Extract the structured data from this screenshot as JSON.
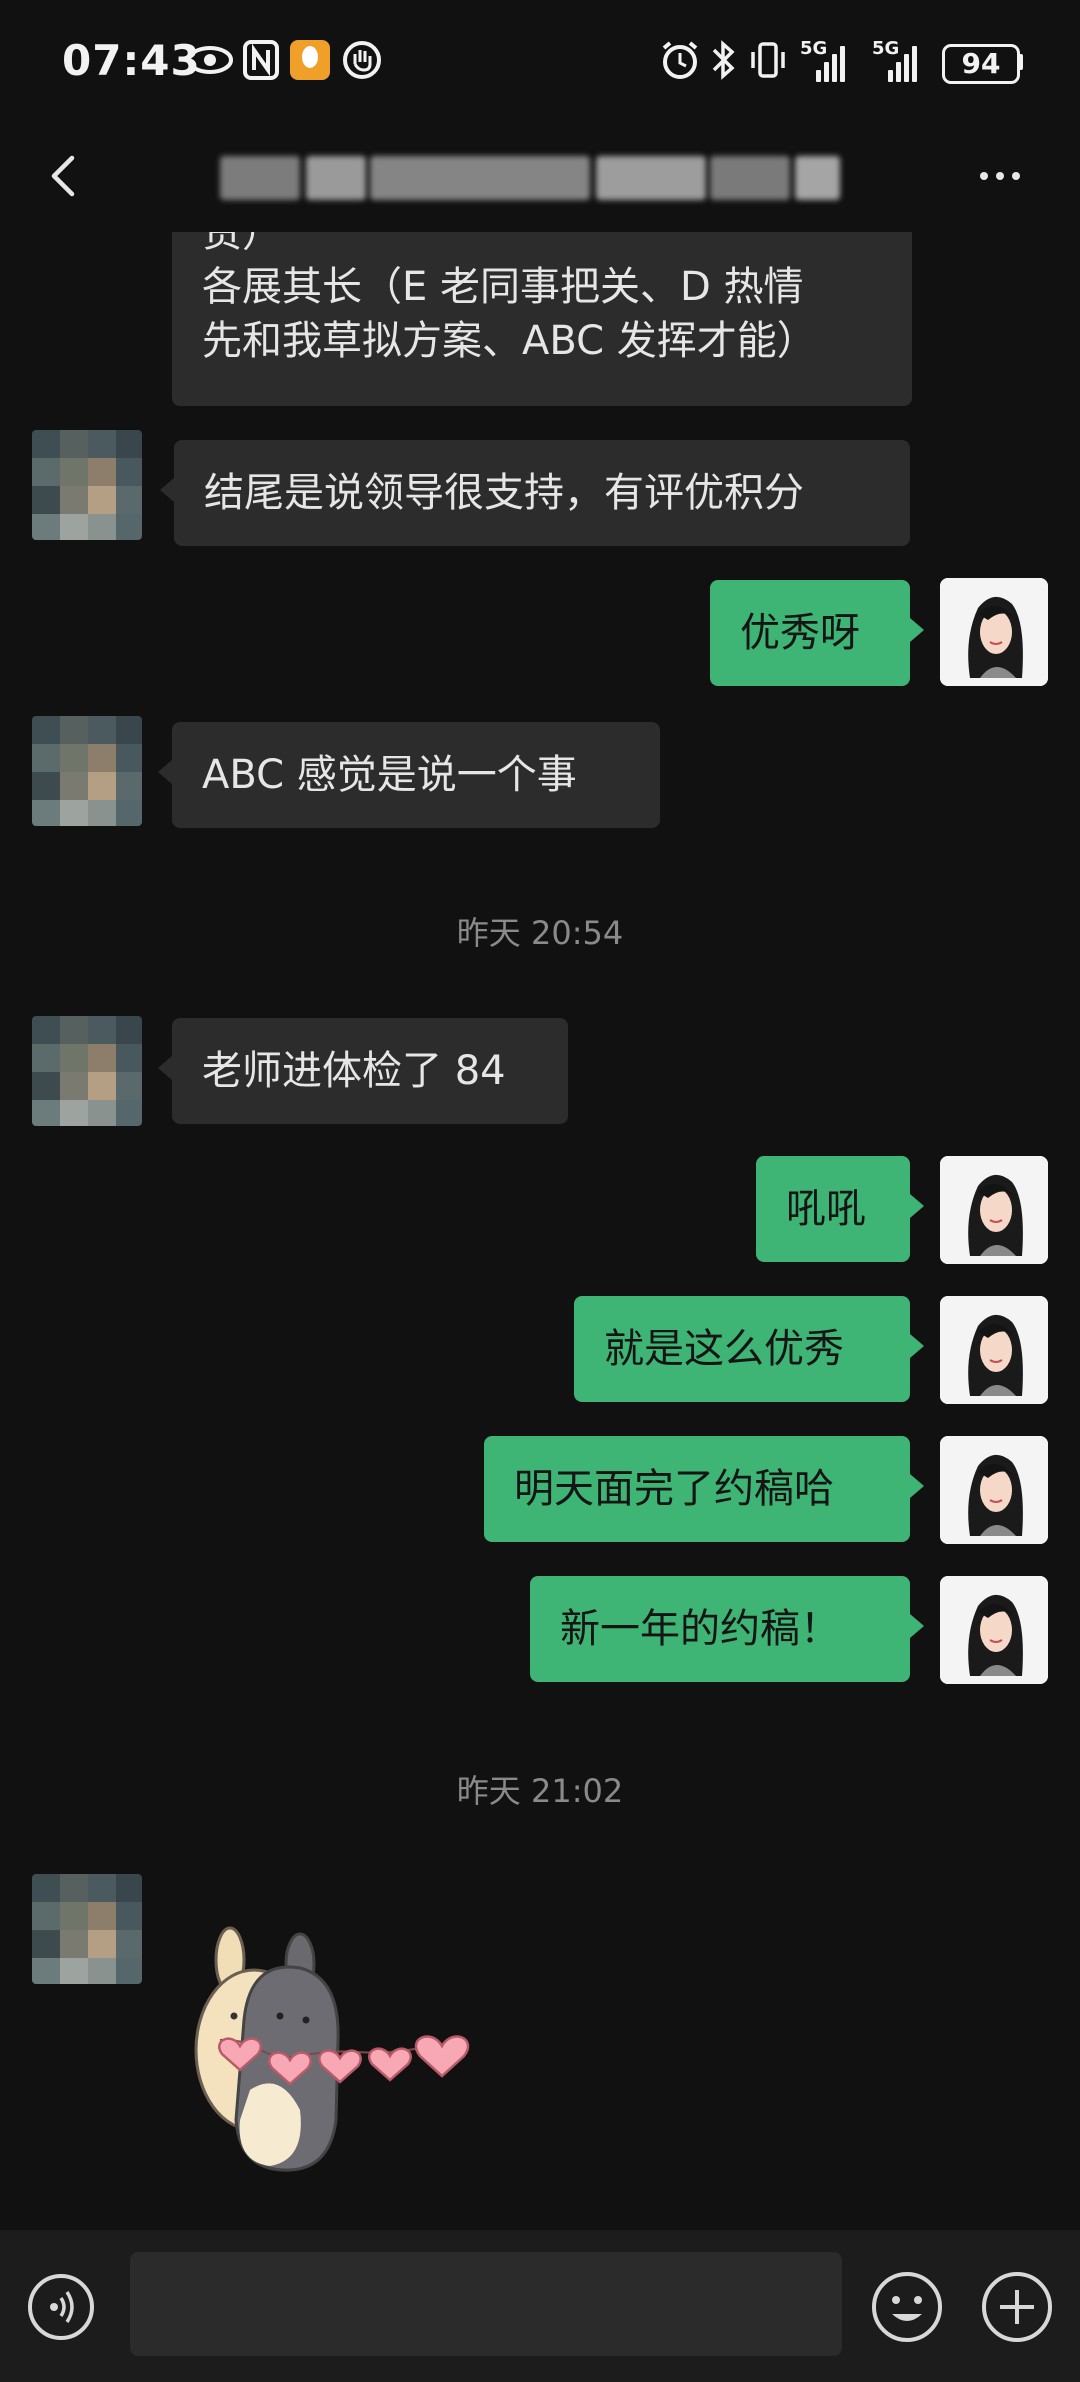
{
  "status_bar": {
    "time": "07:43",
    "signal1_label": "5G",
    "signal2_label": "5G",
    "battery": "94"
  },
  "header": {
    "title": "",
    "back_icon": "chevron-left-icon",
    "more_icon": "more-dots-icon"
  },
  "messages": [
    {
      "side": "in",
      "text_line1": "责）",
      "text_line2": "各展其长（E 老同事把关、D 热情",
      "text_line3": "先和我草拟方案、ABC 发挥才能）"
    },
    {
      "side": "in",
      "text": "结尾是说领导很支持，有评优积分"
    },
    {
      "side": "out",
      "text": "优秀呀"
    },
    {
      "side": "in",
      "text": "ABC 感觉是说一个事"
    },
    {
      "side": "in",
      "text": "老师进体检了 84"
    },
    {
      "side": "out",
      "text": "吼吼"
    },
    {
      "side": "out",
      "text": "就是这么优秀"
    },
    {
      "side": "out",
      "text": "明天面完了约稿哈"
    },
    {
      "side": "out",
      "text": "新一年的约稿！"
    }
  ],
  "timestamps": [
    "昨天 20:54",
    "昨天 21:02"
  ],
  "input_bar": {
    "value": "",
    "voice_icon": "voice-icon",
    "emoji_icon": "emoji-icon",
    "add_icon": "plus-circle-icon"
  },
  "colors": {
    "background": "#111111",
    "incoming_bubble": "#2c2c2c",
    "outgoing_bubble": "#3eb575"
  }
}
